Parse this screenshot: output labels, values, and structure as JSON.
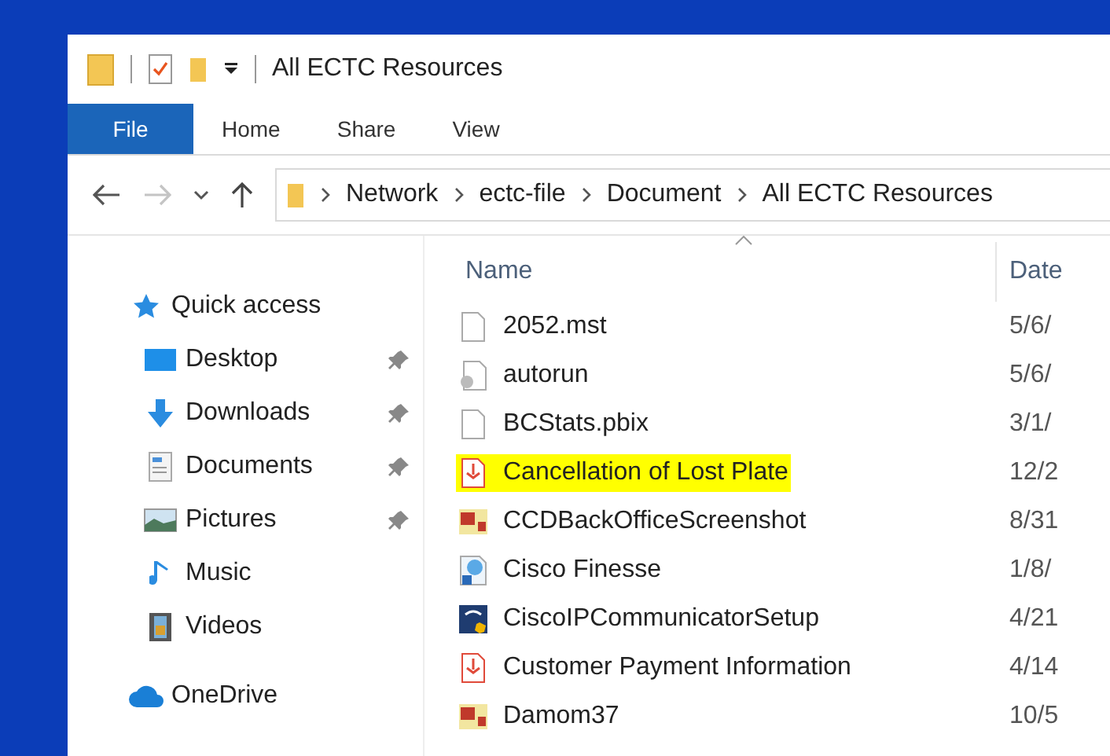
{
  "window": {
    "title": "All ECTC Resources"
  },
  "ribbon_tabs": [
    {
      "label": "File",
      "selected": true
    },
    {
      "label": "Home",
      "selected": false
    },
    {
      "label": "Share",
      "selected": false
    },
    {
      "label": "View",
      "selected": false
    }
  ],
  "address_bar": {
    "path": [
      "Network",
      "ectc-file",
      "Document",
      "All ECTC Resources"
    ]
  },
  "sidebar": {
    "items": [
      {
        "label": "Quick access",
        "kind": "star",
        "pinned": false,
        "children": [
          {
            "label": "Desktop",
            "kind": "desktop",
            "pinned": true
          },
          {
            "label": "Downloads",
            "kind": "download",
            "pinned": true
          },
          {
            "label": "Documents",
            "kind": "document",
            "pinned": true
          },
          {
            "label": "Pictures",
            "kind": "pictures",
            "pinned": true
          },
          {
            "label": "Music",
            "kind": "music",
            "pinned": false
          },
          {
            "label": "Videos",
            "kind": "videos",
            "pinned": false
          }
        ]
      },
      {
        "label": "OneDrive",
        "kind": "cloud",
        "pinned": false
      }
    ]
  },
  "file_list": {
    "columns": [
      "Name",
      "Date"
    ],
    "rows": [
      {
        "name": "2052.mst",
        "date": "5/6/",
        "kind": "blank",
        "highlighted": false
      },
      {
        "name": "autorun",
        "date": "5/6/",
        "kind": "settings",
        "highlighted": false
      },
      {
        "name": "BCStats.pbix",
        "date": "3/1/",
        "kind": "blank",
        "highlighted": false
      },
      {
        "name": "Cancellation of Lost Plate",
        "date": "12/2",
        "kind": "pdf",
        "highlighted": true
      },
      {
        "name": "CCDBackOfficeScreenshot",
        "date": "8/31",
        "kind": "image",
        "highlighted": false
      },
      {
        "name": "Cisco Finesse",
        "date": "1/8/",
        "kind": "shortcut",
        "highlighted": false
      },
      {
        "name": "CiscoIPCommunicatorSetup",
        "date": "4/21",
        "kind": "installer",
        "highlighted": false
      },
      {
        "name": "Customer Payment Information",
        "date": "4/14",
        "kind": "pdf",
        "highlighted": false
      },
      {
        "name": "Damom37",
        "date": "10/5",
        "kind": "image",
        "highlighted": false
      }
    ]
  }
}
